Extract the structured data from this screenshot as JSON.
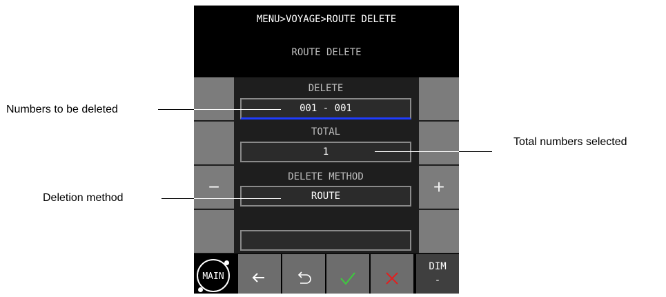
{
  "header": {
    "breadcrumb": "MENU>VOYAGE>ROUTE DELETE",
    "title": "ROUTE DELETE"
  },
  "fields": {
    "delete": {
      "label": "DELETE",
      "value": "001 - 001"
    },
    "total": {
      "label": "TOTAL",
      "value": "1"
    },
    "method": {
      "label": "DELETE METHOD",
      "value": "ROUTE"
    },
    "extra": {
      "value": ""
    }
  },
  "side_buttons": {
    "minus": "−",
    "plus": "+"
  },
  "bottom_bar": {
    "main": "MAIN",
    "dim": "DIM",
    "dim_sub": "-",
    "back_icon": "arrow-left-icon",
    "undo_icon": "undo-icon",
    "confirm_icon": "checkmark-icon",
    "cancel_icon": "x-icon"
  },
  "annotations": {
    "delete_numbers": "Numbers to be deleted",
    "total_selected": "Total numbers selected",
    "deletion_method": "Deletion method"
  },
  "colors": {
    "screen_bg": "#000000",
    "field_active_underline": "#1f3cff",
    "confirm_green": "#3ccc3c",
    "cancel_red": "#e02020"
  }
}
